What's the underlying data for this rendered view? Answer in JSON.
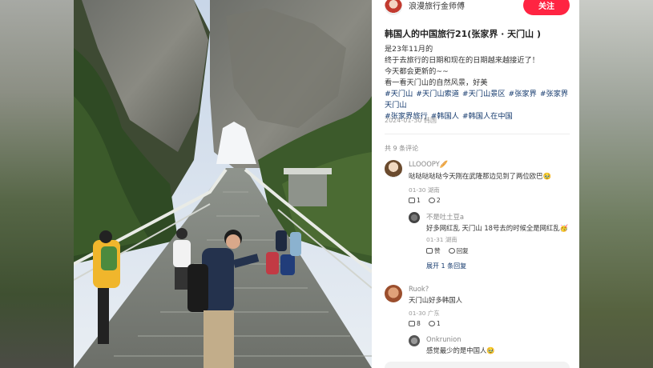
{
  "post": {
    "author": "浪漫旅行金师傅",
    "follow_label": "关注",
    "title": "韩国人的中国旅行21(张家界 · 天门山 )",
    "body_lines": [
      "是23年11月的",
      "终于去旅行的日期和现在的日期越来越接近了！",
      "今天都会更新的~~",
      "看一看天门山的自然风景，好美"
    ],
    "tags": [
      "#天门山",
      "#天门山索道",
      "#天门山景区",
      "#张家界",
      "#张家界天门山",
      "#张家界旅行",
      "#韩国人",
      "#韩国人在中国"
    ],
    "date": "2024-01-30 韩国"
  },
  "comments": {
    "count_label": "共 9 条评论",
    "items": [
      {
        "name": "LLOOOPY🥖",
        "text": "哒哒哒哒哒今天刚在武隆那边见到了两位欧巴🥹",
        "meta": "01-30 湖南",
        "likes": "1",
        "replies": "2",
        "reply": {
          "name": "不是吐土豆a",
          "text": "好多网红乱 天门山 18号去的时候全是网红乱🥳",
          "meta": "01-31 湖南",
          "like_label": "赞",
          "reply_label": "回复"
        },
        "more": "展开 1 条回复"
      },
      {
        "name": "Ruok?",
        "text": "天门山好多韩国人",
        "meta": "01-30 广东",
        "likes": "8",
        "replies": "1"
      },
      {
        "name": "Onkrunion",
        "text": "感觉最少的是中国人🥹"
      }
    ]
  }
}
